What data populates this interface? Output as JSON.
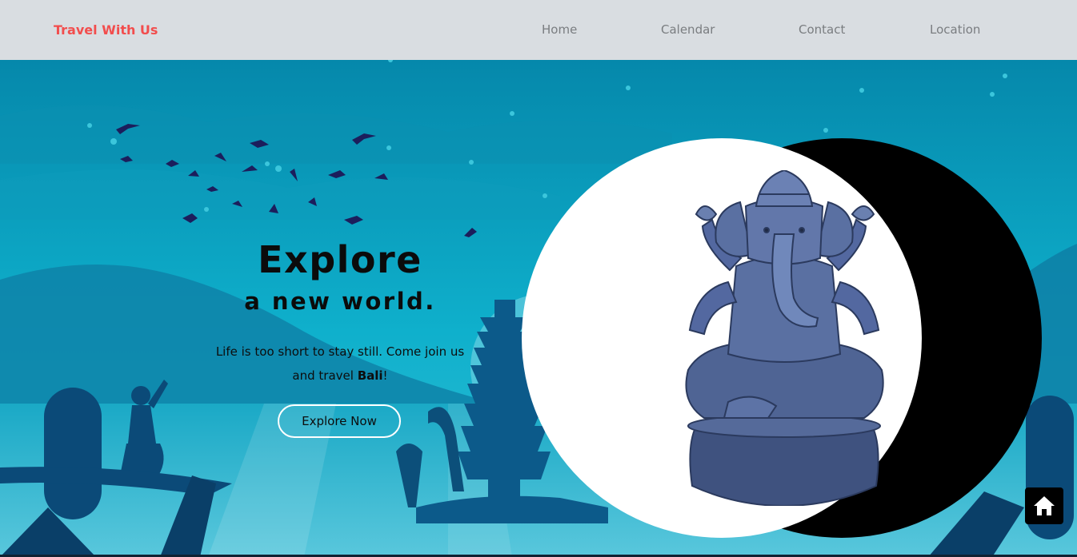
{
  "nav": {
    "brand": "Travel With Us",
    "links": [
      "Home",
      "Calendar",
      "Contact",
      "Location"
    ]
  },
  "hero": {
    "headline_1": "Explore",
    "headline_2": "a new world.",
    "tagline_part1": "Life is too short to stay still. Come join us and travel ",
    "tagline_bold": "Bali",
    "tagline_end": "!",
    "cta_label": "Explore Now"
  },
  "colors": {
    "brand": "#f24d4d",
    "navbar_bg": "#d9dde1",
    "sky": "#0a97b5",
    "silhouette": "#0d4f7a",
    "birds": "#1c1e5c"
  },
  "icons": {
    "home_fab": "home-icon",
    "statue": "ganesha-statue-icon"
  }
}
